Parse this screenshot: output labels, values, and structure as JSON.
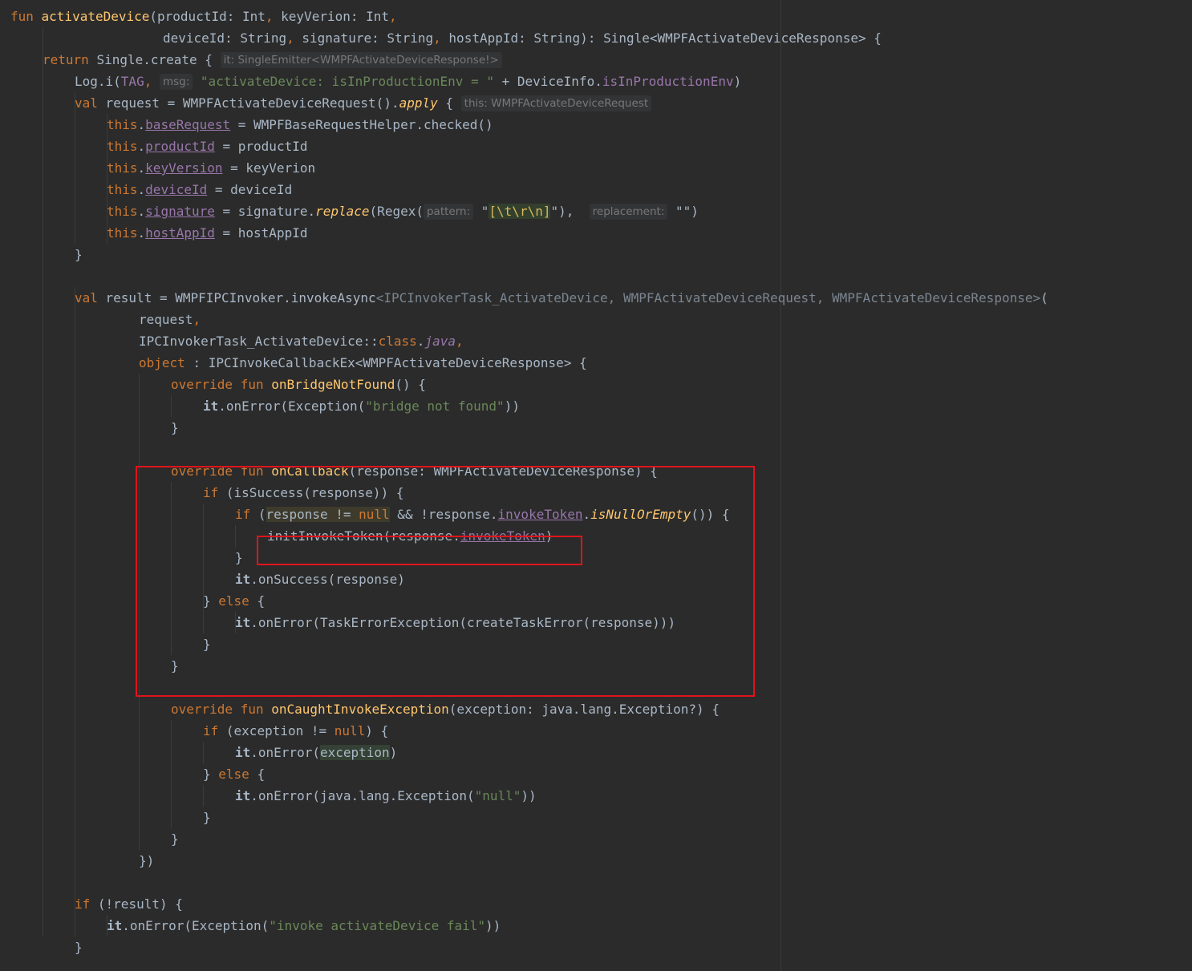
{
  "editor": {
    "lines": [
      [
        [
          "fun ",
          "keyword"
        ],
        [
          "activateDevice",
          "fn"
        ],
        [
          "(productId: Int",
          ""
        ],
        [
          ", ",
          "keyword"
        ],
        [
          "keyVerion: Int",
          ""
        ],
        [
          ",",
          "keyword"
        ]
      ],
      [
        [
          "deviceId: String",
          ""
        ],
        [
          ", ",
          "keyword"
        ],
        [
          "signature: String",
          ""
        ],
        [
          ", ",
          "keyword"
        ],
        [
          "hostAppId: String): Single<WMPFActivateDeviceResponse> {",
          ""
        ]
      ],
      [
        [
          "return ",
          "keyword"
        ],
        [
          "Single.create ",
          ""
        ],
        [
          "{",
          ""
        ],
        [
          " ",
          ""
        ],
        [
          "it: SingleEmitter<WMPFActivateDeviceResponse!>",
          "hint"
        ]
      ],
      [
        [
          "Log.i(",
          ""
        ],
        [
          "TAG",
          "prop"
        ],
        [
          ", ",
          "keyword"
        ],
        [
          "msg:",
          "hint"
        ],
        [
          " ",
          ""
        ],
        [
          "\"activateDevice: isInProductionEnv = \"",
          "string"
        ],
        [
          " + DeviceInfo.",
          ""
        ],
        [
          "isInProductionEnv",
          "prop"
        ],
        [
          ")",
          ""
        ]
      ],
      [
        [
          "val ",
          "keyword"
        ],
        [
          "request = WMPFActivateDeviceRequest().",
          ""
        ],
        [
          "apply",
          "italic-fn"
        ],
        [
          " {",
          ""
        ],
        [
          " ",
          ""
        ],
        [
          "this: WMPFActivateDeviceRequest",
          "hint"
        ]
      ],
      [
        [
          "this",
          "keyword"
        ],
        [
          ".",
          ""
        ],
        [
          "baseRequest",
          "underline"
        ],
        [
          " = WMPFBaseRequestHelper.checked()",
          ""
        ]
      ],
      [
        [
          "this",
          "keyword"
        ],
        [
          ".",
          ""
        ],
        [
          "productId",
          "underline"
        ],
        [
          " = productId",
          ""
        ]
      ],
      [
        [
          "this",
          "keyword"
        ],
        [
          ".",
          ""
        ],
        [
          "keyVersion",
          "underline"
        ],
        [
          " = keyVerion",
          ""
        ]
      ],
      [
        [
          "this",
          "keyword"
        ],
        [
          ".",
          ""
        ],
        [
          "deviceId",
          "underline"
        ],
        [
          " = deviceId",
          ""
        ]
      ],
      [
        [
          "this",
          "keyword"
        ],
        [
          ".",
          ""
        ],
        [
          "signature",
          "underline"
        ],
        [
          " = signature.",
          ""
        ],
        [
          "replace",
          "italic-fn"
        ],
        [
          "(Regex(",
          ""
        ],
        [
          "pattern:",
          "hint"
        ],
        [
          " \"",
          ""
        ],
        [
          "[\\t\\r\\n]",
          "regex"
        ],
        [
          "\"), ",
          ""
        ],
        [
          " ",
          ""
        ],
        [
          "replacement:",
          "hint"
        ],
        [
          " \"\")",
          ""
        ]
      ],
      [
        [
          "this",
          "keyword"
        ],
        [
          ".",
          ""
        ],
        [
          "hostAppId",
          "underline"
        ],
        [
          " = hostAppId",
          ""
        ]
      ],
      [
        [
          "}",
          ""
        ]
      ],
      [],
      [
        [
          "val ",
          "keyword"
        ],
        [
          "result = WMPFIPCInvoker.invokeAsync",
          ""
        ],
        [
          "<IPCInvokerTask_ActivateDevice, WMPFActivateDeviceRequest, WMPFActivateDeviceResponse>",
          "dim"
        ],
        [
          "(",
          ""
        ]
      ],
      [
        [
          "request",
          ""
        ],
        [
          ",",
          "keyword"
        ]
      ],
      [
        [
          "IPCInvokerTask_ActivateDevice::",
          ""
        ],
        [
          "class",
          "keyword"
        ],
        [
          ".",
          ""
        ],
        [
          "java",
          "italic-prop"
        ],
        [
          ",",
          "keyword"
        ]
      ],
      [
        [
          "object ",
          "keyword"
        ],
        [
          ": IPCInvokeCallbackEx<WMPFActivateDeviceResponse> {",
          ""
        ]
      ],
      [
        [
          "override fun ",
          "keyword"
        ],
        [
          "onBridgeNotFound",
          "fn"
        ],
        [
          "() {",
          ""
        ]
      ],
      [
        [
          "it",
          "it"
        ],
        [
          ".onError(Exception(",
          ""
        ],
        [
          "\"bridge not found\"",
          "string"
        ],
        [
          "))",
          ""
        ]
      ],
      [
        [
          "}",
          ""
        ]
      ],
      [],
      [
        [
          "override fun ",
          "keyword"
        ],
        [
          "onCallback",
          "fn"
        ],
        [
          "(response: WMPFActivateDeviceResponse) {",
          ""
        ]
      ],
      [
        [
          "if ",
          "keyword"
        ],
        [
          "(isSuccess(response)) {",
          ""
        ]
      ],
      [
        [
          "if ",
          "keyword"
        ],
        [
          "(",
          ""
        ],
        [
          "response != ",
          "hl-warn"
        ],
        [
          "null",
          "hl-warn-kw"
        ],
        [
          " && !response.",
          ""
        ],
        [
          "invokeToken",
          "underline"
        ],
        [
          ".",
          ""
        ],
        [
          "isNullOrEmpty",
          "italic-fn"
        ],
        [
          "()) {",
          ""
        ]
      ],
      [
        [
          "initInvokeToken(response.",
          ""
        ],
        [
          "invokeToken",
          "underline"
        ],
        [
          ")",
          ""
        ]
      ],
      [
        [
          "}",
          ""
        ]
      ],
      [
        [
          "it",
          "it"
        ],
        [
          ".onSuccess(response)",
          ""
        ]
      ],
      [
        [
          "} ",
          ""
        ],
        [
          "else ",
          "keyword"
        ],
        [
          "{",
          ""
        ]
      ],
      [
        [
          "it",
          "it"
        ],
        [
          ".onError(TaskErrorException(createTaskError(response)))",
          ""
        ]
      ],
      [
        [
          "}",
          ""
        ]
      ],
      [
        [
          "}",
          ""
        ]
      ],
      [],
      [
        [
          "override fun ",
          "keyword"
        ],
        [
          "onCaughtInvokeException",
          "fn"
        ],
        [
          "(exception: java.lang.Exception?) {",
          ""
        ]
      ],
      [
        [
          "if ",
          "keyword"
        ],
        [
          "(exception != ",
          ""
        ],
        [
          "null",
          "keyword"
        ],
        [
          ") {",
          ""
        ]
      ],
      [
        [
          "it",
          "it"
        ],
        [
          ".onError(",
          ""
        ],
        [
          "exception",
          "hl-param"
        ],
        [
          ")",
          ""
        ]
      ],
      [
        [
          "} ",
          ""
        ],
        [
          "else ",
          "keyword"
        ],
        [
          "{",
          ""
        ]
      ],
      [
        [
          "it",
          "it"
        ],
        [
          ".onError(java.lang.Exception(",
          ""
        ],
        [
          "\"null\"",
          "string"
        ],
        [
          "))",
          ""
        ]
      ],
      [
        [
          "}",
          ""
        ]
      ],
      [
        [
          "}",
          ""
        ]
      ],
      [
        [
          "})",
          ""
        ]
      ],
      [],
      [
        [
          "if ",
          "keyword"
        ],
        [
          "(!result) {",
          ""
        ]
      ],
      [
        [
          "it",
          "it"
        ],
        [
          ".onError(Exception(",
          ""
        ],
        [
          "\"invoke activateDevice fail\"",
          "string"
        ],
        [
          "))",
          ""
        ]
      ],
      [
        [
          "}",
          ""
        ]
      ]
    ],
    "indents": [
      0,
      19,
      4,
      8,
      8,
      12,
      12,
      12,
      12,
      12,
      12,
      8,
      0,
      8,
      16,
      16,
      16,
      20,
      24,
      20,
      0,
      20,
      24,
      28,
      32,
      28,
      28,
      24,
      28,
      24,
      20,
      0,
      20,
      24,
      28,
      24,
      28,
      24,
      20,
      16,
      0,
      8,
      12,
      8
    ],
    "colors": {
      "background": "#2b2b2b",
      "keyword": "#cc7832",
      "function": "#ffc66d",
      "string": "#6a8759",
      "property": "#9876aa",
      "text": "#a9b7c6",
      "highlight_box": "#e0141c"
    }
  }
}
